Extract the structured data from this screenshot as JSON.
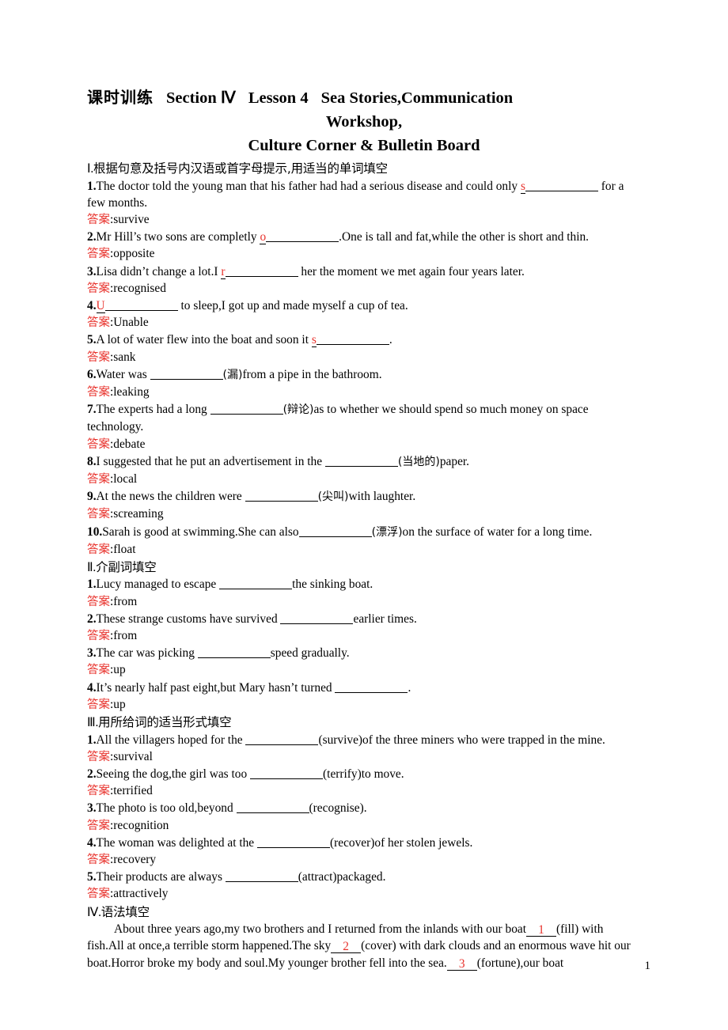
{
  "title": {
    "cn_label": "课时训练",
    "section": "Section Ⅳ",
    "lesson": "Lesson 4",
    "topic1": "Sea Stories,Communication",
    "line2": "Workshop,",
    "line3": "Culture Corner & Bulletin Board"
  },
  "answer_label": "答案",
  "sections": [
    {
      "heading_num": "Ⅰ.",
      "heading_text": "根据句意及括号内汉语或首字母提示,用适当的单词填空",
      "items": [
        {
          "num": "1.",
          "parts": [
            {
              "t": "text",
              "v": "The doctor told the young man that his father had had a serious disease and could only "
            },
            {
              "t": "hint",
              "v": "s"
            },
            {
              "t": "blank",
              "v": "lg"
            },
            {
              "t": "text",
              "v": " for a few months."
            }
          ],
          "answer": "survive"
        },
        {
          "num": "2.",
          "parts": [
            {
              "t": "text",
              "v": "Mr Hill’s two sons are completly "
            },
            {
              "t": "hint",
              "v": "o"
            },
            {
              "t": "blank",
              "v": "lg"
            },
            {
              "t": "text",
              "v": ".One is tall and fat,while the other is short and thin."
            }
          ],
          "answer": "opposite"
        },
        {
          "num": "3.",
          "parts": [
            {
              "t": "text",
              "v": "Lisa didn’t change a lot.I "
            },
            {
              "t": "hint",
              "v": "r"
            },
            {
              "t": "blank",
              "v": "lg"
            },
            {
              "t": "text",
              "v": " her the moment we met again four years later."
            }
          ],
          "answer": "recognised"
        },
        {
          "num": "4.",
          "parts": [
            {
              "t": "hint",
              "v": "U"
            },
            {
              "t": "blank",
              "v": "lg"
            },
            {
              "t": "text",
              "v": " to sleep,I got up and made myself a cup of tea."
            }
          ],
          "answer": "Unable"
        },
        {
          "num": "5.",
          "parts": [
            {
              "t": "text",
              "v": "A lot of water flew into the boat and soon it "
            },
            {
              "t": "hint",
              "v": "s"
            },
            {
              "t": "blank",
              "v": "lg"
            },
            {
              "t": "text",
              "v": "."
            }
          ],
          "answer": "sank"
        },
        {
          "num": "6.",
          "parts": [
            {
              "t": "text",
              "v": "Water was "
            },
            {
              "t": "blank",
              "v": "lg"
            },
            {
              "t": "cjk",
              "v": "(漏)"
            },
            {
              "t": "text",
              "v": "from a pipe in the bathroom."
            }
          ],
          "answer": "leaking"
        },
        {
          "num": "7.",
          "parts": [
            {
              "t": "text",
              "v": "The experts had a long "
            },
            {
              "t": "blank",
              "v": "lg"
            },
            {
              "t": "cjk",
              "v": "(辩论)"
            },
            {
              "t": "text",
              "v": "as to whether we should spend so much money on space technology."
            }
          ],
          "answer": "debate"
        },
        {
          "num": "8.",
          "parts": [
            {
              "t": "text",
              "v": "I suggested that he put an advertisement in the "
            },
            {
              "t": "blank",
              "v": "lg"
            },
            {
              "t": "cjk",
              "v": "(当地的)"
            },
            {
              "t": "text",
              "v": "paper."
            }
          ],
          "answer": "local"
        },
        {
          "num": "9.",
          "parts": [
            {
              "t": "text",
              "v": "At the news the children were "
            },
            {
              "t": "blank",
              "v": "lg"
            },
            {
              "t": "cjk",
              "v": "(尖叫)"
            },
            {
              "t": "text",
              "v": "with laughter."
            }
          ],
          "answer": "screaming"
        },
        {
          "num": "10.",
          "parts": [
            {
              "t": "text",
              "v": "Sarah is good at swimming.She can also"
            },
            {
              "t": "blank",
              "v": "lg"
            },
            {
              "t": "cjk",
              "v": "(漂浮)"
            },
            {
              "t": "text",
              "v": "on the surface of water for a long time."
            }
          ],
          "answer": "float"
        }
      ]
    },
    {
      "heading_num": "Ⅱ.",
      "heading_text": "介副词填空",
      "items": [
        {
          "num": "1.",
          "parts": [
            {
              "t": "text",
              "v": "Lucy managed to escape "
            },
            {
              "t": "blank",
              "v": "lg"
            },
            {
              "t": "text",
              "v": "the sinking boat."
            }
          ],
          "answer": "from"
        },
        {
          "num": "2.",
          "parts": [
            {
              "t": "text",
              "v": "These strange customs have survived "
            },
            {
              "t": "blank",
              "v": "lg"
            },
            {
              "t": "text",
              "v": "earlier times."
            }
          ],
          "answer": "from"
        },
        {
          "num": "3.",
          "parts": [
            {
              "t": "text",
              "v": "The car was picking "
            },
            {
              "t": "blank",
              "v": "lg"
            },
            {
              "t": "text",
              "v": "speed gradually."
            }
          ],
          "answer": "up"
        },
        {
          "num": "4.",
          "parts": [
            {
              "t": "text",
              "v": "It’s nearly half past eight,but Mary hasn’t turned "
            },
            {
              "t": "blank",
              "v": "lg"
            },
            {
              "t": "text",
              "v": "."
            }
          ],
          "answer": "up"
        }
      ]
    },
    {
      "heading_num": "Ⅲ.",
      "heading_text": "用所给词的适当形式填空",
      "items": [
        {
          "num": "1.",
          "parts": [
            {
              "t": "text",
              "v": "All the villagers hoped for the "
            },
            {
              "t": "blank",
              "v": "lg"
            },
            {
              "t": "text",
              "v": "(survive)of the three miners who were trapped in the mine."
            }
          ],
          "answer": "survival"
        },
        {
          "num": "2.",
          "parts": [
            {
              "t": "text",
              "v": "Seeing the dog,the girl was too "
            },
            {
              "t": "blank",
              "v": "lg"
            },
            {
              "t": "text",
              "v": "(terrify)to move."
            }
          ],
          "answer": "terrified"
        },
        {
          "num": "3.",
          "parts": [
            {
              "t": "text",
              "v": "The photo is too old,beyond "
            },
            {
              "t": "blank",
              "v": "lg"
            },
            {
              "t": "text",
              "v": "(recognise)."
            }
          ],
          "answer": "recognition"
        },
        {
          "num": "4.",
          "parts": [
            {
              "t": "text",
              "v": "The woman was delighted at the "
            },
            {
              "t": "blank",
              "v": "lg"
            },
            {
              "t": "text",
              "v": "(recover)of her stolen jewels."
            }
          ],
          "answer": "recovery"
        },
        {
          "num": "5.",
          "parts": [
            {
              "t": "text",
              "v": "Their products are always "
            },
            {
              "t": "blank",
              "v": "lg"
            },
            {
              "t": "text",
              "v": "(attract)packaged."
            }
          ],
          "answer": "attractively"
        }
      ]
    },
    {
      "heading_num": "Ⅳ.",
      "heading_text": "语法填空",
      "items": [],
      "passage": [
        {
          "t": "indent",
          "v": ""
        },
        {
          "t": "text",
          "v": "About three years ago,my two brothers and I returned from the inlands with our boat"
        },
        {
          "t": "numblank",
          "v": "1"
        },
        {
          "t": "text",
          "v": "(fill) with fish.All at once,a terrible storm happened.The sky"
        },
        {
          "t": "numblank",
          "v": "2"
        },
        {
          "t": "text",
          "v": "(cover) with dark clouds and an enormous wave hit our boat.Horror broke my body and soul.My younger brother fell into the sea."
        },
        {
          "t": "numblank",
          "v": "3"
        },
        {
          "t": "text",
          "v": "(fortune),our boat"
        }
      ]
    }
  ],
  "page_number": "1",
  "colors": {
    "answer_red": "#e8322c",
    "text_black": "#000000",
    "background": "#ffffff"
  }
}
